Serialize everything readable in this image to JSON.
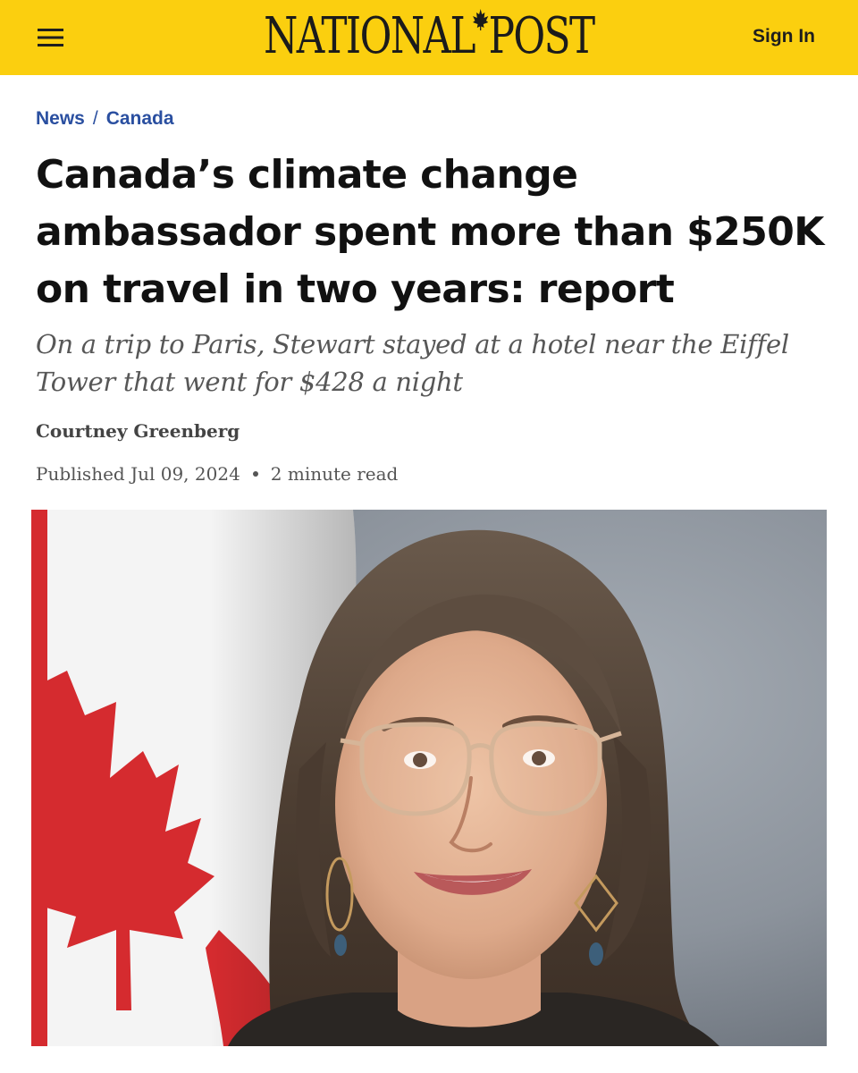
{
  "header": {
    "menu_icon": "hamburger-menu-icon",
    "logo_left": "NATIONAL",
    "logo_right": "POST",
    "logo_icon": "maple-leaf-icon",
    "sign_in_label": "Sign In",
    "background_color": "#fbcf0f"
  },
  "breadcrumb": {
    "items": [
      "News",
      "Canada"
    ],
    "separator": "/",
    "link_color": "#2a4fa0"
  },
  "article": {
    "headline": "Canada’s climate change ambassador spent more than $250K on travel in two years: report",
    "subheadline": "On a trip to Paris, Stewart stayed at a hotel near the Eiffel Tower that went for $428 a night",
    "author": "Courtney Greenberg",
    "published": "Published Jul 09, 2024",
    "read_time": "2 minute read"
  },
  "hero_image": {
    "subject": "portrait-photo",
    "flag": "canadian-flag"
  }
}
